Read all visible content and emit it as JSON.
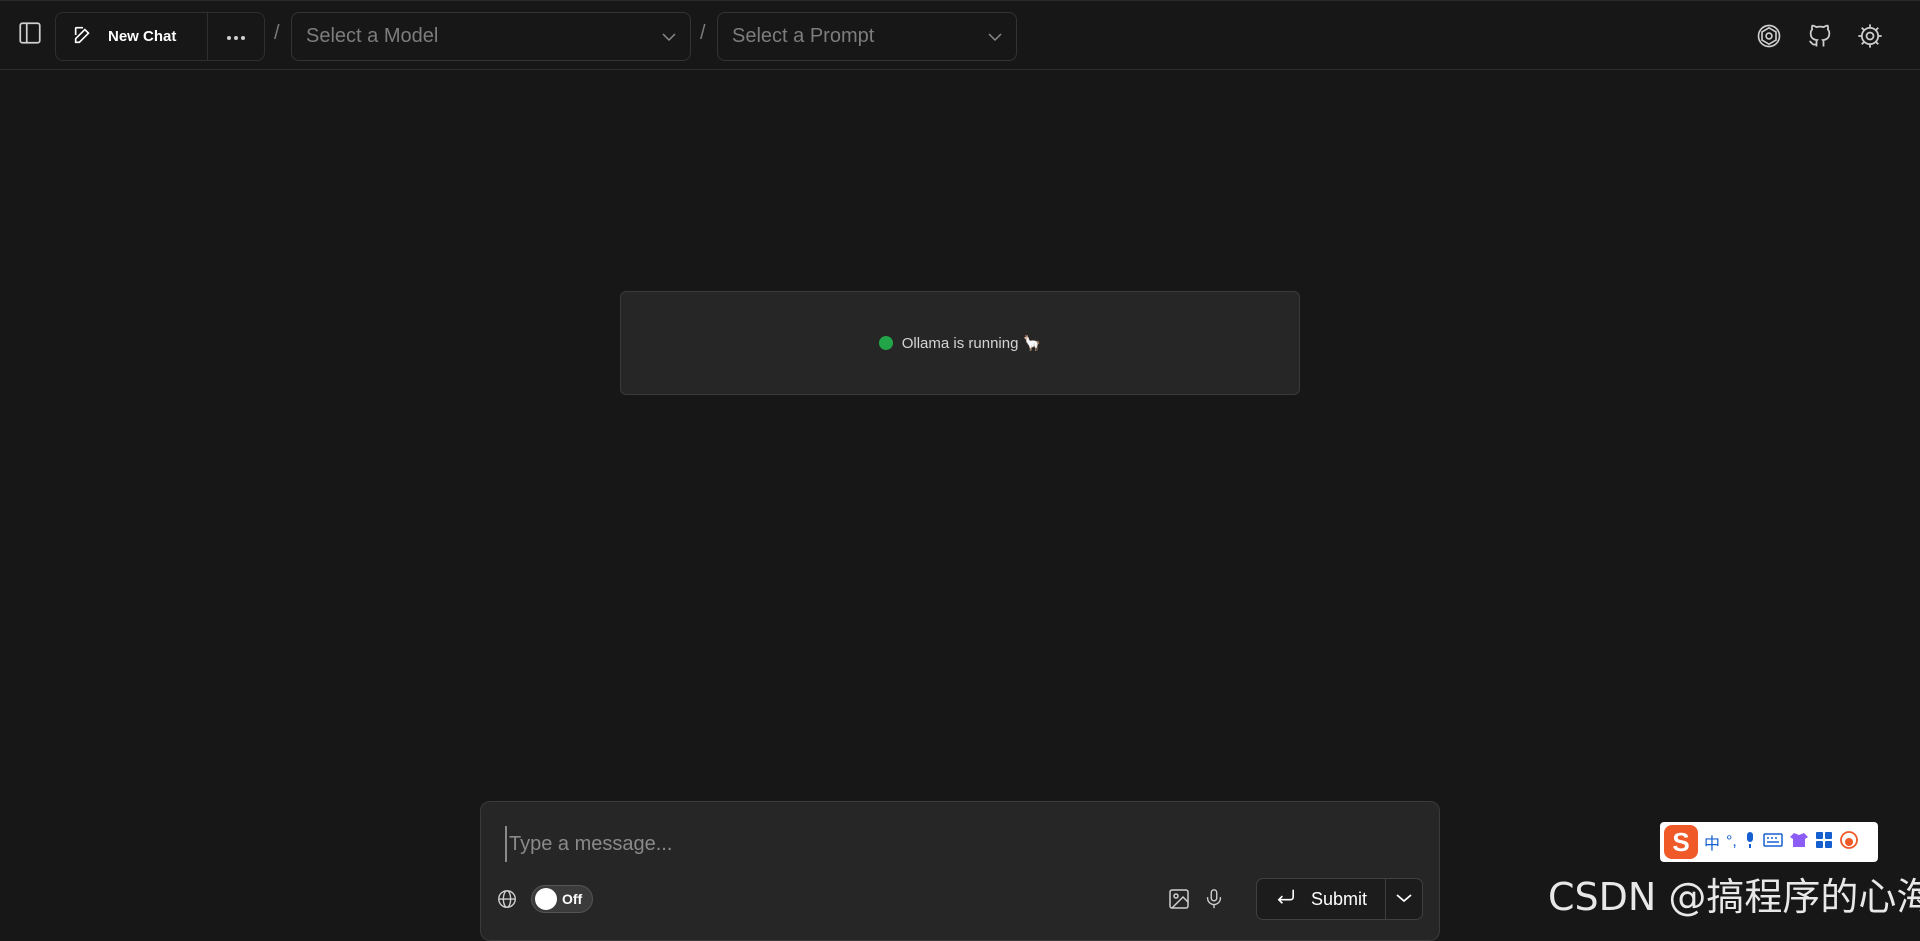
{
  "header": {
    "new_chat_label": "New Chat",
    "separator": "/",
    "model_select_placeholder": "Select a Model",
    "prompt_select_placeholder": "Select a Prompt"
  },
  "status": {
    "text": "Ollama is running 🦙",
    "color": "#22a548"
  },
  "composer": {
    "placeholder": "Type a message...",
    "toggle_label": "Off",
    "submit_label": "Submit"
  },
  "ime_toolbar": {
    "logo": "S",
    "mode": "中",
    "punct": "°,"
  },
  "watermark": "CSDN @搞程序的心海"
}
